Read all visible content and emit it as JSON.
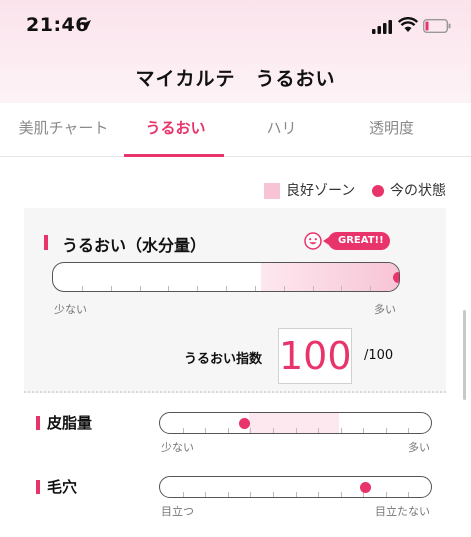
{
  "status_bar": {
    "time": "21:46"
  },
  "header": {
    "title": "マイカルテ　うるおい"
  },
  "tabs": [
    {
      "label": "美肌チャート",
      "active": false
    },
    {
      "label": "うるおい",
      "active": true
    },
    {
      "label": "ハリ",
      "active": false
    },
    {
      "label": "透明度",
      "active": false
    }
  ],
  "legend": {
    "good_zone": "良好ゾーン",
    "current_state": "今の状態"
  },
  "moisture": {
    "title": "うるおい（水分量）",
    "badge": "GREAT!!",
    "scale_low": "少ない",
    "scale_high": "多い",
    "good_zone_range": [
      0.6,
      1.0
    ],
    "current_fraction": 1.0,
    "index_label": "うるおい指数",
    "index_value": "100",
    "index_max": "/100"
  },
  "sebum": {
    "title": "皮脂量",
    "scale_low": "少ない",
    "scale_high": "多い",
    "good_zone_range": [
      0.33,
      0.66
    ],
    "current_fraction": 0.31
  },
  "pores": {
    "title": "毛穴",
    "scale_low": "目立つ",
    "scale_high": "目立たない",
    "current_fraction": 0.76
  },
  "colors": {
    "accent": "#e8336b",
    "zone": "#f7c4d6",
    "zone_light": "#fde8ef"
  }
}
